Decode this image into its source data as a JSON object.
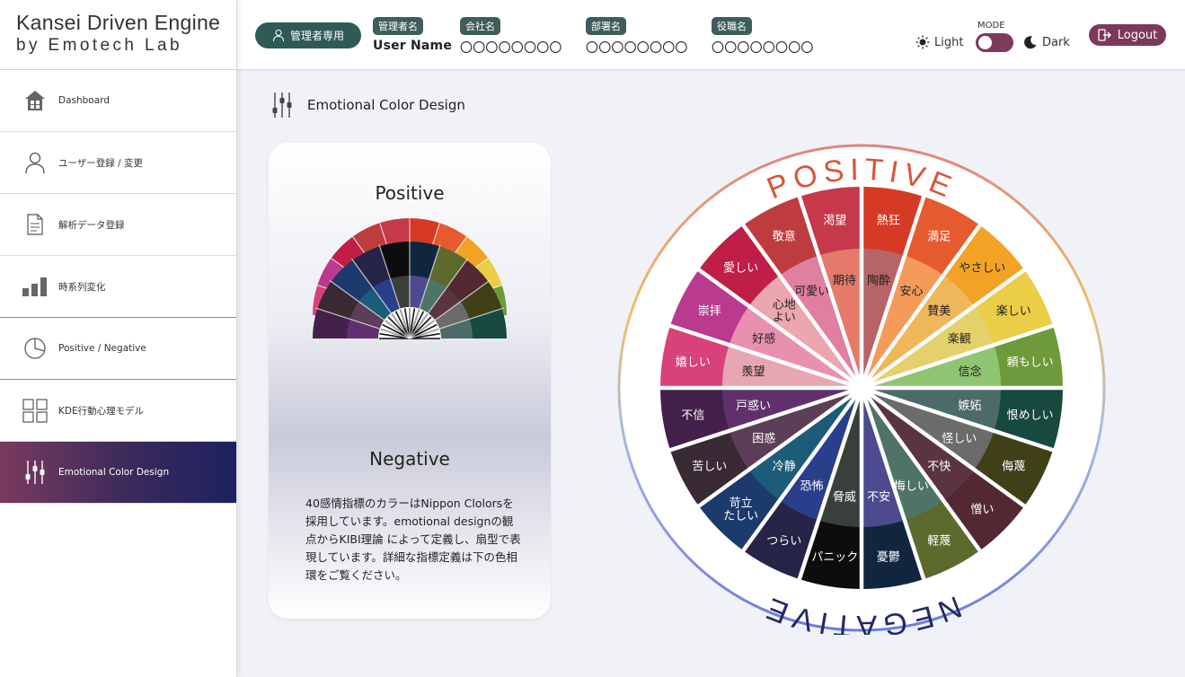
{
  "brand": {
    "line1": "Kansei Driven Engine",
    "line2": "by Emotech Lab"
  },
  "sidebar": {
    "items": [
      {
        "label": "Dashboard",
        "icon": "home-icon"
      },
      {
        "label": "ユーザー登録 / 変更",
        "icon": "user-icon"
      },
      {
        "label": "解析データ登録",
        "icon": "document-icon"
      },
      {
        "label": "時系列変化",
        "icon": "bar-chart-icon"
      },
      {
        "label": "Positive / Negative",
        "icon": "pie-chart-icon"
      },
      {
        "label": "KDE行動心理モデル",
        "icon": "grid-icon"
      },
      {
        "label": "Emotional Color Design",
        "icon": "sliders-icon",
        "active": true
      }
    ]
  },
  "header": {
    "admin_badge": "管理者専用",
    "fields": [
      {
        "tag": "管理者名",
        "value": "User Name"
      },
      {
        "tag": "会社名",
        "value": "〇〇〇〇〇〇〇〇"
      },
      {
        "tag": "部署名",
        "value": "〇〇〇〇〇〇〇〇"
      },
      {
        "tag": "役職名",
        "value": "〇〇〇〇〇〇〇〇"
      }
    ],
    "mode_label": "MODE",
    "light_label": "Light",
    "dark_label": "Dark",
    "logout_label": "Logout"
  },
  "main": {
    "page_title": "Emotional Color Design",
    "card": {
      "positive_label": "Positive",
      "negative_label": "Negative",
      "description": "40感情指標のカラーはNippon Clolorsを採用しています。emotional designの観点からKIBI理論 によって定義し、扇型で表現しています。詳細な指標定義は下の色相環をご覧ください。"
    },
    "wheel": {
      "positive_title": "POSITIVE",
      "negative_title": "NEGATIVE",
      "colors": {
        "white": "#ffffff"
      },
      "outer": [
        {
          "label": "熱狂",
          "color": "#d63a25"
        },
        {
          "label": "満足",
          "color": "#e65a2f"
        },
        {
          "label": "やさしい",
          "color": "#f2a326"
        },
        {
          "label": "楽しい",
          "color": "#eccd47"
        },
        {
          "label": "頼もしい",
          "color": "#6e9a3a"
        },
        {
          "label": "恨めしい",
          "color": "#17493f"
        },
        {
          "label": "侮蔑",
          "color": "#3f3f18"
        },
        {
          "label": "憎い",
          "color": "#532833"
        },
        {
          "label": "軽蔑",
          "color": "#5c6a2e"
        },
        {
          "label": "憂鬱",
          "color": "#10263f"
        },
        {
          "label": "パニック",
          "color": "#0d0d0d"
        },
        {
          "label": "つらい",
          "color": "#262547"
        },
        {
          "label": "苛立たしい",
          "color": "#1d3a6c"
        },
        {
          "label": "苦しい",
          "color": "#392a33"
        },
        {
          "label": "不信",
          "color": "#44214a"
        },
        {
          "label": "嬉しい",
          "color": "#d8417a"
        },
        {
          "label": "崇拝",
          "color": "#b93a8e"
        },
        {
          "label": "愛しい",
          "color": "#bf1e47"
        },
        {
          "label": "敬意",
          "color": "#be3b3e"
        },
        {
          "label": "渇望",
          "color": "#c5394b"
        }
      ],
      "inner": [
        {
          "label": "陶酔",
          "color": "#b76468"
        },
        {
          "label": "安心",
          "color": "#f59b5a"
        },
        {
          "label": "賛美",
          "color": "#f0b65a"
        },
        {
          "label": "楽観",
          "color": "#e5d16b"
        },
        {
          "label": "信念",
          "color": "#8fc471"
        },
        {
          "label": "嫉妬",
          "color": "#4c6b68"
        },
        {
          "label": "怪しい",
          "color": "#6b6b6b"
        },
        {
          "label": "不快",
          "color": "#5a3540"
        },
        {
          "label": "悔しい",
          "color": "#4f7467"
        },
        {
          "label": "不安",
          "color": "#4d4a90"
        },
        {
          "label": "脅威",
          "color": "#393f3a"
        },
        {
          "label": "恐怖",
          "color": "#2a3f8c"
        },
        {
          "label": "冷静",
          "color": "#1c5c79"
        },
        {
          "label": "困惑",
          "color": "#5c3e58"
        },
        {
          "label": "戸惑い",
          "color": "#60306d"
        },
        {
          "label": "羨望",
          "color": "#e6a7b3"
        },
        {
          "label": "好感",
          "color": "#e990b1"
        },
        {
          "label": "心地よい",
          "color": "#eca6ae"
        },
        {
          "label": "可愛い",
          "color": "#e07fa0"
        },
        {
          "label": "期待",
          "color": "#e5796a"
        }
      ]
    }
  }
}
